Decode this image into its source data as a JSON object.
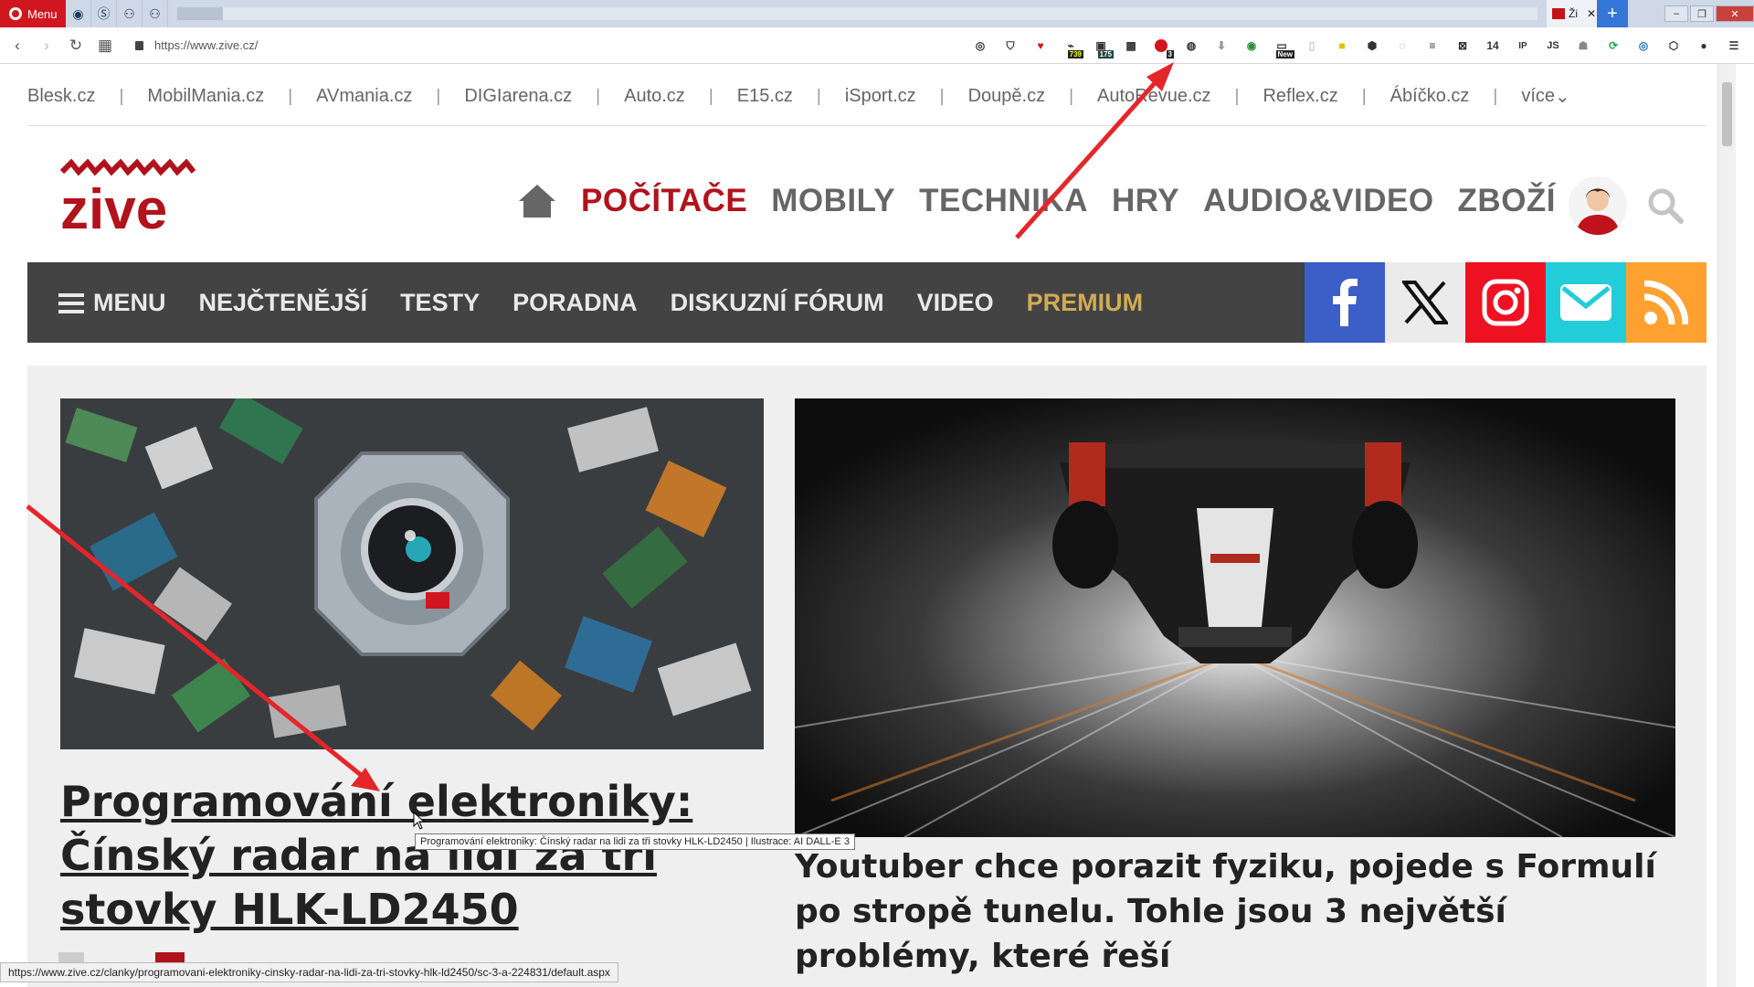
{
  "browser": {
    "menu_label": "Menu",
    "tab_title": "Ži",
    "url": "https://www.zive.cz/",
    "extension_badges": [
      "739",
      "175",
      "3",
      "New"
    ],
    "tab_count": "14",
    "ext_ip": "IP",
    "ext_js": "JS"
  },
  "sites_nav": {
    "items": [
      "Blesk.cz",
      "MobilMania.cz",
      "AVmania.cz",
      "DIGIarena.cz",
      "Auto.cz",
      "E15.cz",
      "iSport.cz",
      "Doupě.cz",
      "AutoRevue.cz",
      "Reflex.cz",
      "Ábíčko.cz"
    ],
    "more": "více"
  },
  "logo_text": "zive",
  "top_nav": {
    "items": [
      "POČÍTAČE",
      "MOBILY",
      "TECHNIKA",
      "HRY",
      "AUDIO&VIDEO",
      "ZBOŽÍ"
    ],
    "active_index": 0
  },
  "menu_bar": {
    "menu_label": "MENU",
    "items": [
      "NEJČTENĚJŠÍ",
      "TESTY",
      "PORADNA",
      "DISKUZNÍ FÓRUM",
      "VIDEO",
      "PREMIUM"
    ]
  },
  "social": [
    {
      "name": "facebook",
      "color": "#3b5ec7"
    },
    {
      "name": "x",
      "color": "#ebebeb"
    },
    {
      "name": "instagram",
      "color": "#ee1122"
    },
    {
      "name": "email",
      "color": "#22ccd9"
    },
    {
      "name": "rss",
      "color": "#ffa131"
    }
  ],
  "articles": [
    {
      "title": "Programování elektroniky: Čínský radar na lidi za tři stovky HLK-LD2450"
    },
    {
      "title": "Youtuber chce porazit fyziku, pojede s Formulí po stropě tunelu. Tohle jsou 3 největší problémy, které řeší"
    }
  ],
  "tooltip": "Programování elektroniky: Čínský radar na lidi za tři stovky HLK-LD2450 | Ilustrace: AI DALL-E 3",
  "status_url": "https://www.zive.cz/clanky/programovani-elektroniky-cinsky-radar-na-lidi-za-tri-stovky-hlk-ld2450/sc-3-a-224831/default.aspx",
  "colors": {
    "brand_red": "#b1121b",
    "menubar": "#434343",
    "premium": "#d2ab55",
    "annotation_arrow": "#e4262a"
  }
}
